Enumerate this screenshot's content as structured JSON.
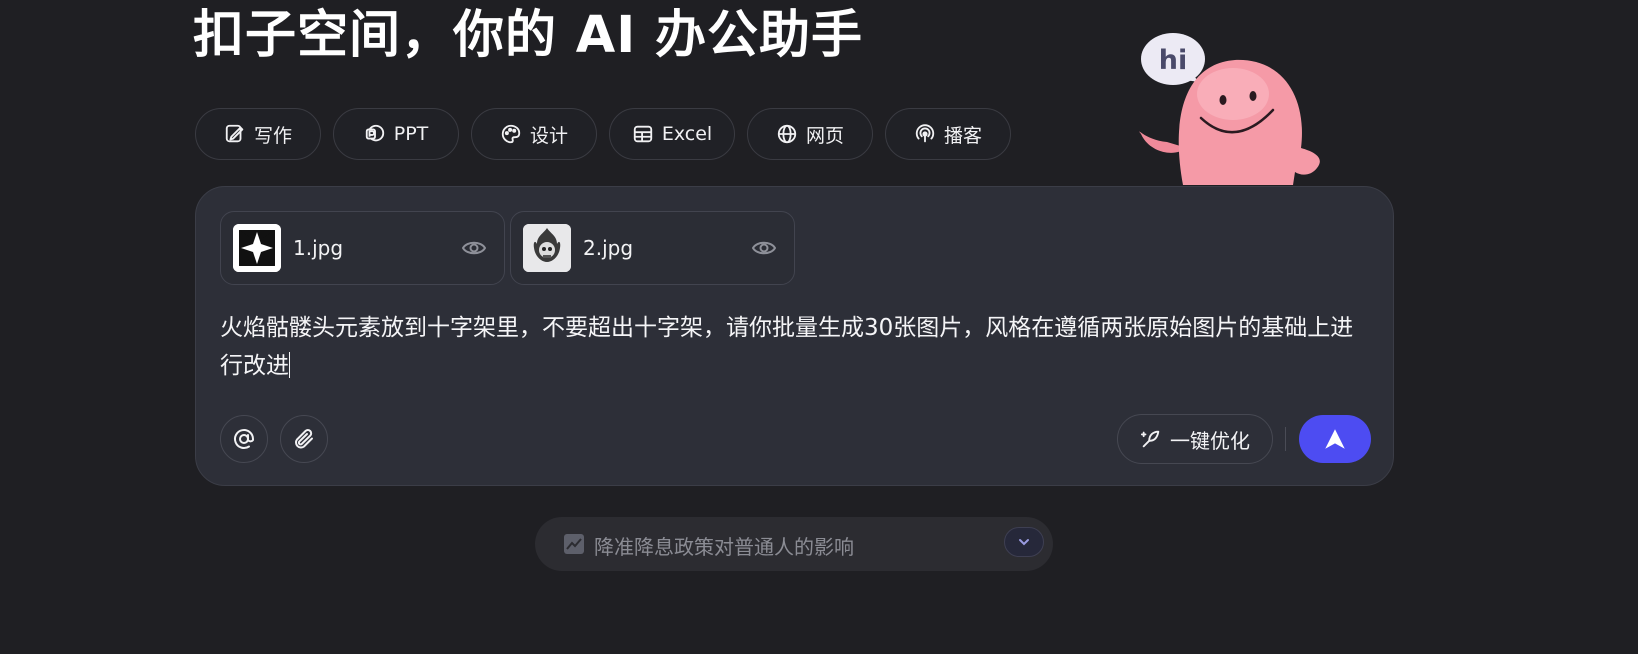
{
  "header": {
    "title": "扣子空间，你的 AI 办公助手"
  },
  "mascot": {
    "bubble_text": "hi"
  },
  "modes": [
    {
      "label": "写作",
      "icon": "edit-icon"
    },
    {
      "label": "PPT",
      "icon": "ppt-icon"
    },
    {
      "label": "设计",
      "icon": "palette-icon"
    },
    {
      "label": "Excel",
      "icon": "table-icon"
    },
    {
      "label": "网页",
      "icon": "globe-icon"
    },
    {
      "label": "播客",
      "icon": "podcast-icon"
    }
  ],
  "attachments": [
    {
      "name": "1.jpg",
      "thumb": "iron-cross-image"
    },
    {
      "name": "2.jpg",
      "thumb": "flaming-skull-image"
    }
  ],
  "prompt": {
    "text": "火焰骷髅头元素放到十字架里，不要超出十字架，请你批量生成30张图片，风格在遵循两张原始图片的基础上进行改进"
  },
  "toolbar": {
    "mention_icon": "at-icon",
    "attach_icon": "paperclip-icon",
    "optimize_label": "一键优化",
    "send_icon": "send-arrow-icon"
  },
  "suggestion": {
    "icon": "trend-chart-icon",
    "text": "降准降息政策对普通人的影响",
    "toggle_icon": "chevron-down-icon"
  },
  "colors": {
    "background": "#1f1f23",
    "composer": "#2d2f38",
    "accent": "#4d4cf2"
  }
}
